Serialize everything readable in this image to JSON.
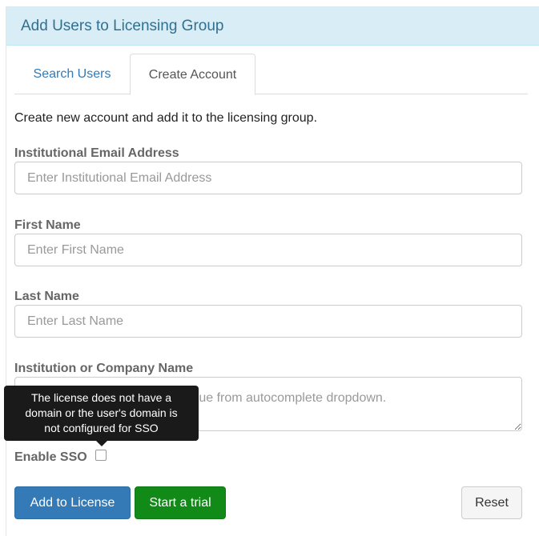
{
  "panel": {
    "title": "Add Users to Licensing Group"
  },
  "tabs": [
    {
      "label": "Search Users",
      "active": false
    },
    {
      "label": "Create Account",
      "active": true
    }
  ],
  "form": {
    "intro": "Create new account and add it to the licensing group.",
    "email": {
      "label": "Institutional Email Address",
      "placeholder": "Enter Institutional Email Address",
      "value": ""
    },
    "first_name": {
      "label": "First Name",
      "placeholder": "Enter First Name",
      "value": ""
    },
    "last_name": {
      "label": "Last Name",
      "placeholder": "Enter Last Name",
      "value": ""
    },
    "institution": {
      "label": "Institution or Company Name",
      "placeholder": "Enter Institution or select a value from autocomplete dropdown.",
      "value": ""
    },
    "sso": {
      "label": "Enable SSO",
      "checked": false
    }
  },
  "tooltip": {
    "lines": [
      "The license does not have a",
      "domain or the user's domain is",
      "not configured for SSO"
    ]
  },
  "buttons": {
    "add_to_license": "Add to License",
    "start_trial": "Start a trial",
    "reset": "Reset"
  },
  "colors": {
    "heading_bg": "#d9edf7",
    "heading_text": "#31708f",
    "primary": "#337ab7",
    "success": "#118a18"
  }
}
